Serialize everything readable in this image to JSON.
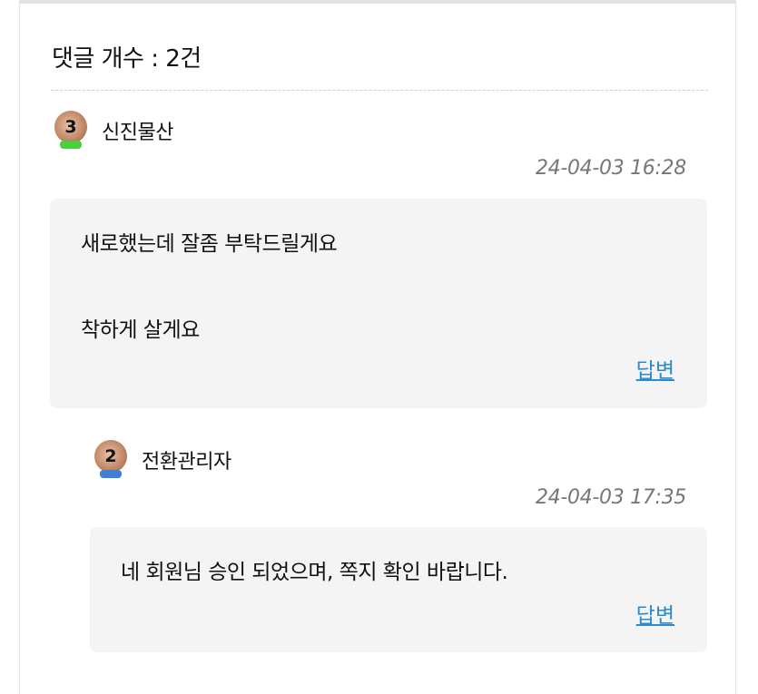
{
  "header": {
    "comment_count_label": "댓글 개수 : 2건"
  },
  "comments": [
    {
      "author": "신진물산",
      "level": "3",
      "bow_color": "#4ccf3c",
      "date": "24-04-03 16:28",
      "lines": [
        "새로했는데 잘좀 부탁드릴게요",
        "착하게 살게요"
      ],
      "reply_label": "답변"
    },
    {
      "author": "전환관리자",
      "level": "2",
      "bow_color": "#3f7fd6",
      "date": "24-04-03 17:35",
      "lines": [
        "네 회원님 승인 되었으며, 쪽지 확인 바랍니다."
      ],
      "reply_label": "답변"
    }
  ],
  "colors": {
    "link": "#2a8bd0",
    "bubble_bg": "#f4f4f4",
    "date": "#777777"
  }
}
